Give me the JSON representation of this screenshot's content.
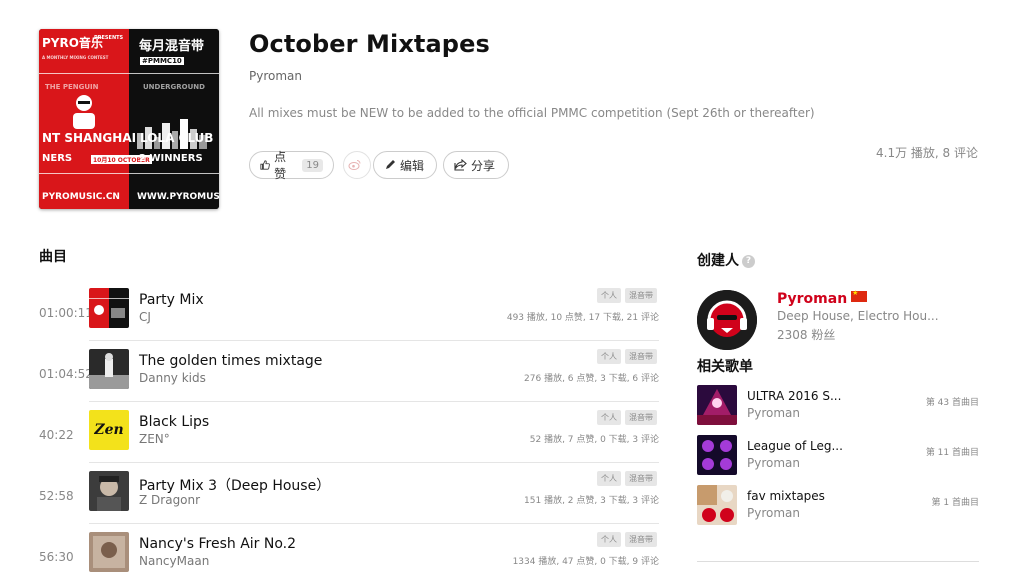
{
  "playlist": {
    "title": "October Mixtapes",
    "author": "Pyroman",
    "description": "All mixes must be NEW to be added to the official PMMC competition (Sept 26th or thereafter)",
    "stats": "4.1万 播放, 8 评论",
    "cover": {
      "top_left_brand": "PYRO音乐",
      "top_left_presents": "PRESENTS",
      "top_left_sub": "A MONTHLY MIXING CONTEST",
      "top_right_title": "每月混音带",
      "top_right_code": "#PMMC10",
      "mid_left_label": "THE PENGUIN",
      "mid_left_venue": "NT SHANGHAI",
      "mid_right_label": "UNDERGROUND",
      "mid_right_venue": "LOLA CLUB",
      "bottom_left_winners": "NERS",
      "bottom_left_date": "10月10 OCTOBER",
      "bottom_right_winners": "2 WINNERS",
      "bottom_left_url": "PYROMUSIC.CN",
      "bottom_right_url": "WWW.PYROMUSIC.C"
    }
  },
  "actions": {
    "like_label": "点赞",
    "like_count": "19",
    "edit_label": "编辑",
    "share_label": "分享"
  },
  "tracks_section": {
    "title": "曲目",
    "items": [
      {
        "duration": "01:00:11",
        "name": "Party Mix",
        "artist": "CJ",
        "tags": [
          "个人",
          "混音带"
        ],
        "meta": "493 播放, 10 点赞, 17 下载, 21 评论",
        "thumb_color": "#c9161b"
      },
      {
        "duration": "01:04:52",
        "name": "The golden times mixtage",
        "artist": "Danny kids",
        "tags": [
          "个人",
          "混音带"
        ],
        "meta": "276 播放, 6 点赞, 3 下载, 6 评论",
        "thumb_color": "#2a2a2a"
      },
      {
        "duration": "40:22",
        "name": "Black Lips",
        "artist": "ZEN°",
        "tags": [
          "个人",
          "混音带"
        ],
        "meta": "52 播放, 7 点赞, 0 下载, 3 评论",
        "thumb_color": "#f3e21b"
      },
      {
        "duration": "52:58",
        "name": "Party Mix 3（Deep House）",
        "artist": "Z Dragonr",
        "tags": [
          "个人",
          "混音带"
        ],
        "meta": "151 播放, 2 点赞, 3 下载, 3 评论",
        "thumb_color": "#3c3c3c"
      },
      {
        "duration": "56:30",
        "name": "Nancy's Fresh Air No.2",
        "artist": "NancyMaan",
        "tags": [
          "个人",
          "混音带"
        ],
        "meta": "1334 播放, 47 点赞, 0 下载, 9 评论",
        "thumb_color": "#a98f7b"
      }
    ],
    "zen_logo": "Zen"
  },
  "sidebar": {
    "creator_title": "创建人",
    "help_glyph": "?",
    "creator": {
      "name": "Pyroman",
      "genres": "Deep House, Electro Hou...",
      "fans": "2308 粉丝"
    },
    "related_title": "相关歌单",
    "related": [
      {
        "name": "ULTRA 2016 S...",
        "author": "Pyroman",
        "count": "第 43 首曲目"
      },
      {
        "name": "League of Leg...",
        "author": "Pyroman",
        "count": "第 11 首曲目"
      },
      {
        "name": "fav mixtapes",
        "author": "Pyroman",
        "count": "第 1 首曲目"
      }
    ]
  }
}
